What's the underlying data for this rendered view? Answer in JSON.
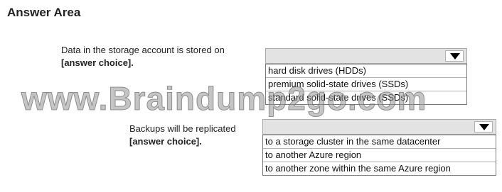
{
  "title": "Answer Area",
  "questions": [
    {
      "prompt": "Data in the storage account is stored on",
      "placeholder": "[answer choice].",
      "options": [
        "hard disk drives (HDDs)",
        "premium solid-state drives (SSDs)",
        "standard solid-state drives (SSDs)"
      ]
    },
    {
      "prompt": "Backups will be replicated",
      "placeholder": "[answer choice].",
      "options": [
        "to a storage cluster in the same datacenter",
        "to another Azure region",
        "to another zone within the same Azure region"
      ]
    }
  ],
  "watermark": "www.Braindump2go.com",
  "icons": {
    "dropdown": "triangle-down-icon"
  }
}
